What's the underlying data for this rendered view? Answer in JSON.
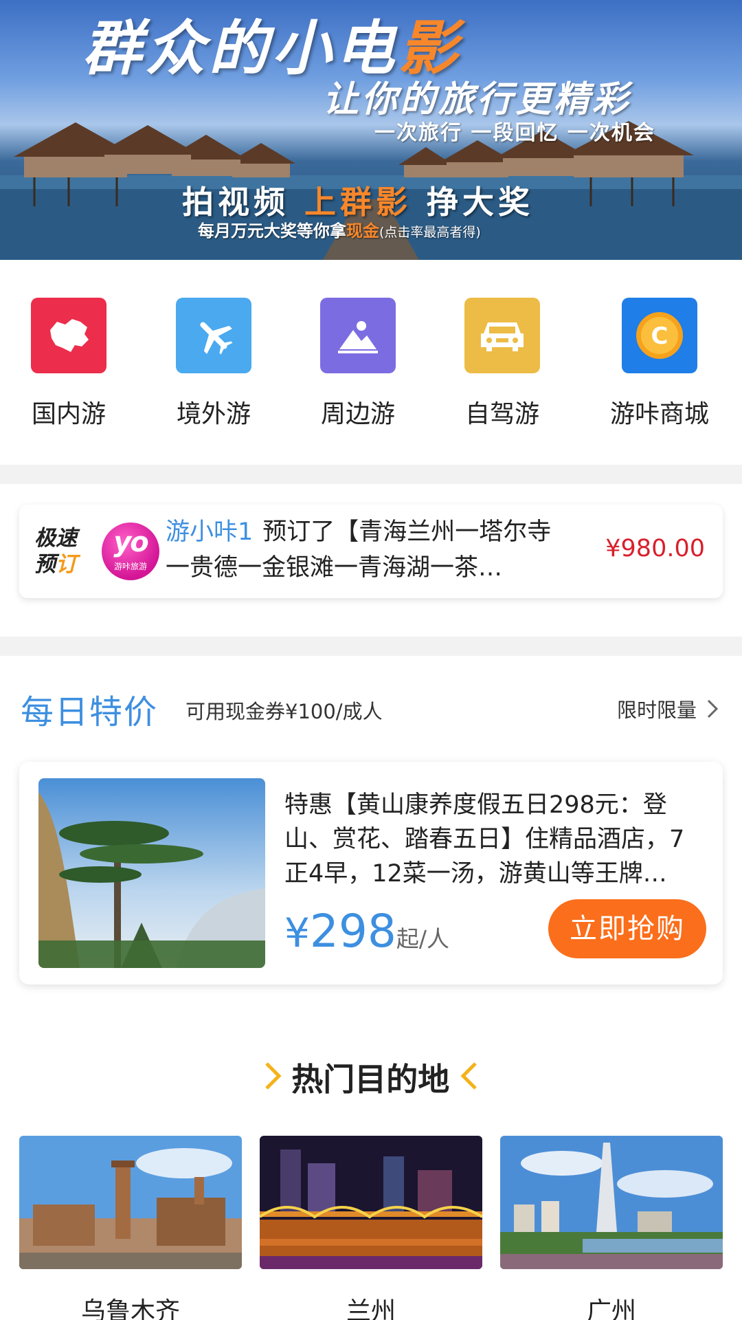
{
  "banner": {
    "title_part1": "群众的小电",
    "title_part2": "影",
    "subtitle": "让你的旅行更精彩",
    "tagline": "一次旅行 一段回忆 一次机会",
    "slogan_part1": "拍视频 ",
    "slogan_highlight": "上群影",
    "slogan_part2": " 挣大奖",
    "note_part1": "每月万元大奖等你拿",
    "note_highlight": "现金",
    "note_small": "(点击率最高者得)"
  },
  "categories": [
    {
      "label": "国内游",
      "color": "#ec2d4b",
      "icon": "china-map-icon"
    },
    {
      "label": "境外游",
      "color": "#4aa9ef",
      "icon": "airplane-icon"
    },
    {
      "label": "周边游",
      "color": "#7b6de1",
      "icon": "landscape-icon"
    },
    {
      "label": "自驾游",
      "color": "#edbc46",
      "icon": "car-icon"
    },
    {
      "label": "游咔商城",
      "color": "#1f7ee8",
      "icon": "coin-icon"
    }
  ],
  "ticker": {
    "badge_line1": "极速",
    "badge_line2_a": "预",
    "badge_line2_b": "订",
    "avatar_text": "yo",
    "avatar_sub": "游咔旅游",
    "user": "游小咔1",
    "text": "预订了【青海兰州一塔尔寺一贵德一金银滩一青海湖一茶…",
    "price": "¥980.00"
  },
  "daily": {
    "title": "每日特价",
    "subtitle": "可用现金券¥100/成人",
    "more": "限时限量"
  },
  "deal": {
    "text": "特惠【黄山康养度假五日298元：登山、赏花、踏春五日】住精品酒店，7正4早，12菜一汤，游黄山等王牌…",
    "currency": "¥",
    "price": "298",
    "unit": "起/人",
    "buy_label": "立即抢购"
  },
  "hot": {
    "title": "热门目的地",
    "destinations": [
      {
        "name": "乌鲁木齐"
      },
      {
        "name": "兰州"
      },
      {
        "name": "广州"
      }
    ]
  },
  "colors": {
    "accent_blue": "#3d8fe0",
    "price_red": "#d8202c",
    "buy_orange": "#fb6e1b",
    "chevron_yellow": "#f4b21a"
  }
}
